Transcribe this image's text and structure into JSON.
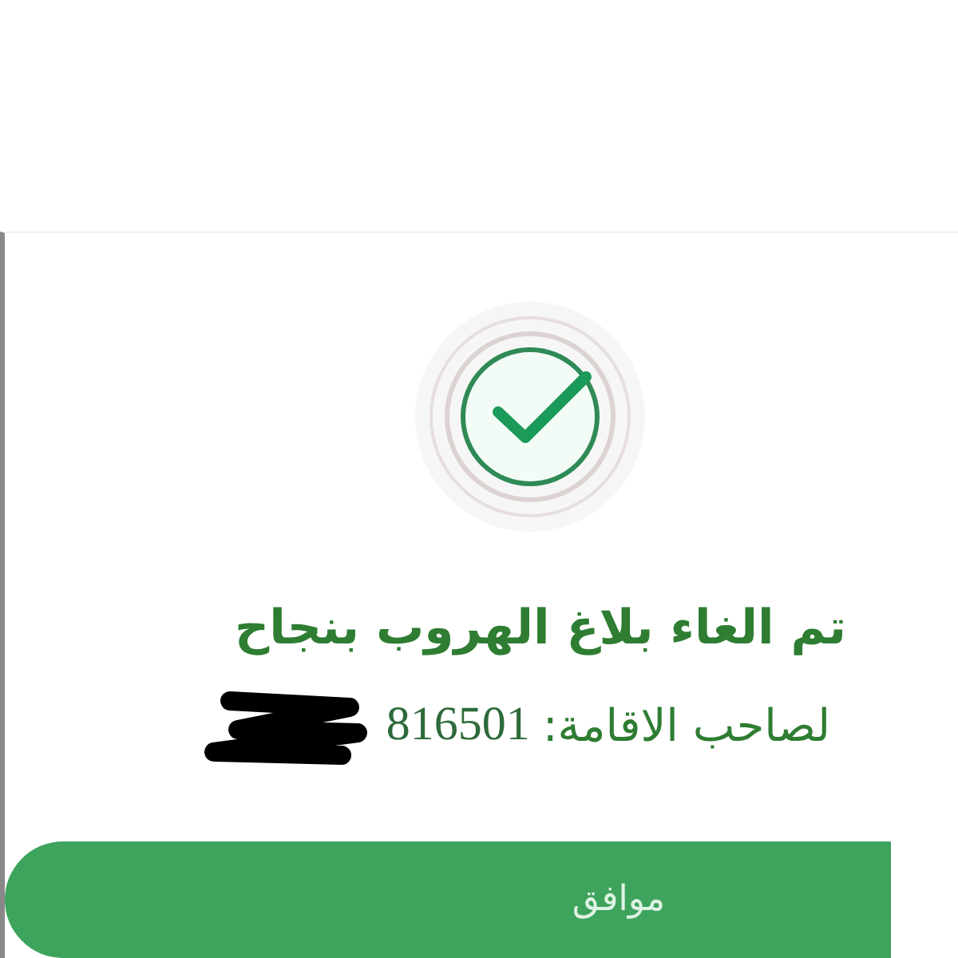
{
  "dialog": {
    "title": "تم الغاء بلاغ الهروب بنجاح",
    "id_label": "لصاحب الاقامة:",
    "id_number": "816501",
    "button": "موافق"
  }
}
